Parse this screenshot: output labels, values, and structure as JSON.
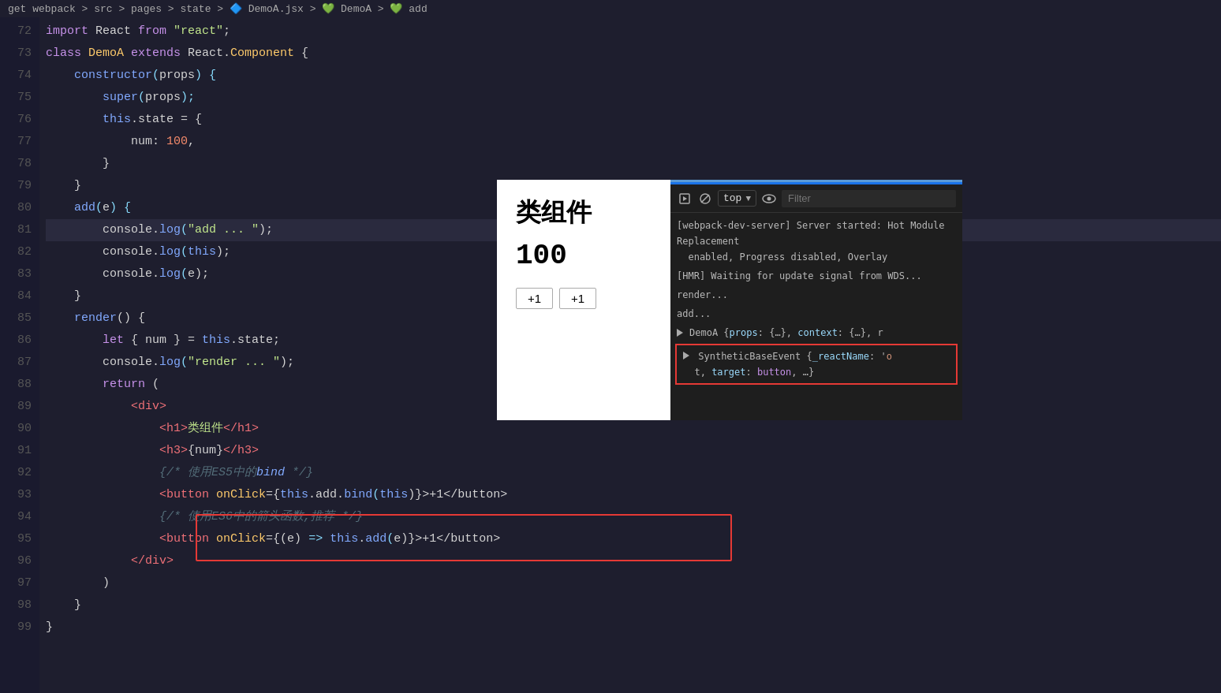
{
  "breadcrumb": {
    "parts": [
      "get webpack",
      ">",
      "src",
      ">",
      "pages",
      ">",
      "state",
      ">",
      "🔷 DemoA.jsx",
      ">",
      "💚 DemoA",
      ">",
      "💚 add"
    ]
  },
  "editor": {
    "lines": [
      {
        "num": 72,
        "tokens": [
          {
            "t": "import",
            "c": "kw-import"
          },
          {
            "t": " React ",
            "c": "plain"
          },
          {
            "t": "from",
            "c": "kw-from"
          },
          {
            "t": " ",
            "c": "plain"
          },
          {
            "t": "\"react\"",
            "c": "str"
          },
          {
            "t": ";",
            "c": "plain"
          }
        ]
      },
      {
        "num": 73,
        "tokens": [
          {
            "t": "class",
            "c": "kw-class"
          },
          {
            "t": " ",
            "c": "plain"
          },
          {
            "t": "DemoA",
            "c": "class-name"
          },
          {
            "t": " ",
            "c": "plain"
          },
          {
            "t": "extends",
            "c": "kw-extends"
          },
          {
            "t": " React.",
            "c": "plain"
          },
          {
            "t": "Component",
            "c": "class-name"
          },
          {
            "t": " {",
            "c": "plain"
          }
        ]
      },
      {
        "num": 74,
        "tokens": [
          {
            "t": "    ",
            "c": "plain"
          },
          {
            "t": "constructor",
            "c": "fn-name"
          },
          {
            "t": "(",
            "c": "paren"
          },
          {
            "t": "props",
            "c": "plain"
          },
          {
            "t": ") {",
            "c": "paren"
          }
        ]
      },
      {
        "num": 75,
        "tokens": [
          {
            "t": "        ",
            "c": "plain"
          },
          {
            "t": "super",
            "c": "fn-name"
          },
          {
            "t": "(",
            "c": "paren"
          },
          {
            "t": "props",
            "c": "plain"
          },
          {
            "t": ");",
            "c": "paren"
          }
        ]
      },
      {
        "num": 76,
        "tokens": [
          {
            "t": "        ",
            "c": "plain"
          },
          {
            "t": "this",
            "c": "kw-this"
          },
          {
            "t": ".state = {",
            "c": "plain"
          }
        ]
      },
      {
        "num": 77,
        "tokens": [
          {
            "t": "            ",
            "c": "plain"
          },
          {
            "t": "num",
            "c": "plain"
          },
          {
            "t": ": ",
            "c": "plain"
          },
          {
            "t": "100",
            "c": "num"
          },
          {
            "t": ",",
            "c": "plain"
          }
        ]
      },
      {
        "num": 78,
        "tokens": [
          {
            "t": "        ",
            "c": "plain"
          },
          {
            "t": "}",
            "c": "plain"
          }
        ]
      },
      {
        "num": 79,
        "tokens": [
          {
            "t": "    ",
            "c": "plain"
          },
          {
            "t": "}",
            "c": "plain"
          }
        ]
      },
      {
        "num": 80,
        "tokens": [
          {
            "t": "    ",
            "c": "plain"
          },
          {
            "t": "add",
            "c": "fn-name"
          },
          {
            "t": "(",
            "c": "paren"
          },
          {
            "t": "e",
            "c": "plain"
          },
          {
            "t": ") {",
            "c": "paren"
          }
        ]
      },
      {
        "num": 81,
        "tokens": [
          {
            "t": "        ",
            "c": "plain"
          },
          {
            "t": "console",
            "c": "plain"
          },
          {
            "t": ".",
            "c": "plain"
          },
          {
            "t": "log",
            "c": "method"
          },
          {
            "t": "(",
            "c": "paren"
          },
          {
            "t": "\"add ... \"",
            "c": "str"
          },
          {
            "t": ");",
            "c": "plain"
          }
        ],
        "highlighted": true
      },
      {
        "num": 82,
        "tokens": [
          {
            "t": "        ",
            "c": "plain"
          },
          {
            "t": "console",
            "c": "plain"
          },
          {
            "t": ".",
            "c": "plain"
          },
          {
            "t": "log",
            "c": "method"
          },
          {
            "t": "(",
            "c": "paren"
          },
          {
            "t": "this",
            "c": "kw-this"
          },
          {
            "t": ");",
            "c": "plain"
          }
        ]
      },
      {
        "num": 83,
        "tokens": [
          {
            "t": "        ",
            "c": "plain"
          },
          {
            "t": "console",
            "c": "plain"
          },
          {
            "t": ".",
            "c": "plain"
          },
          {
            "t": "log",
            "c": "method"
          },
          {
            "t": "(",
            "c": "paren"
          },
          {
            "t": "e",
            "c": "plain"
          },
          {
            "t": ");",
            "c": "plain"
          }
        ]
      },
      {
        "num": 84,
        "tokens": [
          {
            "t": "    ",
            "c": "plain"
          },
          {
            "t": "}",
            "c": "plain"
          }
        ]
      },
      {
        "num": 85,
        "tokens": [
          {
            "t": "    ",
            "c": "plain"
          },
          {
            "t": "render",
            "c": "fn-name"
          },
          {
            "t": "() {",
            "c": "plain"
          }
        ]
      },
      {
        "num": 86,
        "tokens": [
          {
            "t": "        ",
            "c": "plain"
          },
          {
            "t": "let",
            "c": "kw-let"
          },
          {
            "t": " { ",
            "c": "plain"
          },
          {
            "t": "num",
            "c": "plain"
          },
          {
            "t": " } = ",
            "c": "plain"
          },
          {
            "t": "this",
            "c": "kw-this"
          },
          {
            "t": ".state;",
            "c": "plain"
          }
        ]
      },
      {
        "num": 87,
        "tokens": [
          {
            "t": "        ",
            "c": "plain"
          },
          {
            "t": "console",
            "c": "plain"
          },
          {
            "t": ".",
            "c": "plain"
          },
          {
            "t": "log",
            "c": "method"
          },
          {
            "t": "(",
            "c": "paren"
          },
          {
            "t": "\"render ... \"",
            "c": "str"
          },
          {
            "t": ");",
            "c": "plain"
          }
        ]
      },
      {
        "num": 88,
        "tokens": [
          {
            "t": "        ",
            "c": "plain"
          },
          {
            "t": "return",
            "c": "kw-return"
          },
          {
            "t": " (",
            "c": "plain"
          }
        ]
      },
      {
        "num": 89,
        "tokens": [
          {
            "t": "            ",
            "c": "plain"
          },
          {
            "t": "<",
            "c": "tag"
          },
          {
            "t": "div",
            "c": "tag"
          },
          {
            "t": ">",
            "c": "tag"
          }
        ]
      },
      {
        "num": 90,
        "tokens": [
          {
            "t": "                ",
            "c": "plain"
          },
          {
            "t": "<",
            "c": "tag"
          },
          {
            "t": "h1",
            "c": "tag"
          },
          {
            "t": ">",
            "c": "tag"
          },
          {
            "t": "类组件",
            "c": "jsx-text"
          },
          {
            "t": "</",
            "c": "tag"
          },
          {
            "t": "h1",
            "c": "tag"
          },
          {
            "t": ">",
            "c": "tag"
          }
        ]
      },
      {
        "num": 91,
        "tokens": [
          {
            "t": "                ",
            "c": "plain"
          },
          {
            "t": "<",
            "c": "tag"
          },
          {
            "t": "h3",
            "c": "tag"
          },
          {
            "t": ">",
            "c": "tag"
          },
          {
            "t": "{",
            "c": "plain"
          },
          {
            "t": "num",
            "c": "plain"
          },
          {
            "t": "}",
            "c": "plain"
          },
          {
            "t": "</",
            "c": "tag"
          },
          {
            "t": "h3",
            "c": "tag"
          },
          {
            "t": ">",
            "c": "tag"
          }
        ]
      },
      {
        "num": 92,
        "tokens": [
          {
            "t": "                ",
            "c": "plain"
          },
          {
            "t": "{/* 使用ES5中的",
            "c": "comment"
          },
          {
            "t": "bind",
            "c": "comment"
          },
          {
            "t": " */}",
            "c": "comment"
          }
        ]
      },
      {
        "num": 93,
        "tokens": [
          {
            "t": "                ",
            "c": "plain"
          },
          {
            "t": "<",
            "c": "tag"
          },
          {
            "t": "button",
            "c": "tag"
          },
          {
            "t": " ",
            "c": "plain"
          },
          {
            "t": "onClick",
            "c": "attr"
          },
          {
            "t": "=",
            "c": "plain"
          },
          {
            "t": "{",
            "c": "plain"
          },
          {
            "t": "this",
            "c": "kw-this"
          },
          {
            "t": ".add.",
            "c": "plain"
          },
          {
            "t": "bind",
            "c": "method"
          },
          {
            "t": "(",
            "c": "paren"
          },
          {
            "t": "this",
            "c": "kw-this"
          },
          {
            "t": ")}",
            "c": "plain"
          },
          {
            "t": ">",
            "c": "tag"
          },
          {
            "t": "+1",
            "c": "plain"
          },
          {
            "t": "</",
            "c": "tag"
          },
          {
            "t": "button",
            "c": "tag"
          },
          {
            "t": ">",
            "c": "tag"
          }
        ]
      },
      {
        "num": 94,
        "tokens": [
          {
            "t": "                ",
            "c": "plain"
          },
          {
            "t": "{/* 使用ES6中的箭头函数,推荐 */}",
            "c": "comment"
          }
        ],
        "redBorder": true
      },
      {
        "num": 95,
        "tokens": [
          {
            "t": "                ",
            "c": "plain"
          },
          {
            "t": "<",
            "c": "tag"
          },
          {
            "t": "button",
            "c": "tag"
          },
          {
            "t": " ",
            "c": "plain"
          },
          {
            "t": "onClick",
            "c": "attr"
          },
          {
            "t": "=",
            "c": "plain"
          },
          {
            "t": "{(",
            "c": "plain"
          },
          {
            "t": "e",
            "c": "plain"
          },
          {
            "t": ") ",
            "c": "plain"
          },
          {
            "t": "=>",
            "c": "arrow"
          },
          {
            "t": " ",
            "c": "plain"
          },
          {
            "t": "this",
            "c": "kw-this"
          },
          {
            "t": ".",
            "c": "plain"
          },
          {
            "t": "add",
            "c": "method"
          },
          {
            "t": "(",
            "c": "paren"
          },
          {
            "t": "e",
            "c": "plain"
          },
          {
            "t": ")}",
            "c": "plain"
          },
          {
            "t": ">",
            "c": "tag"
          },
          {
            "t": "+1",
            "c": "plain"
          },
          {
            "t": "</",
            "c": "tag"
          },
          {
            "t": "button",
            "c": "tag"
          },
          {
            "t": ">",
            "c": "tag"
          }
        ],
        "redBorder": true
      },
      {
        "num": 96,
        "tokens": [
          {
            "t": "            ",
            "c": "plain"
          },
          {
            "t": "</",
            "c": "tag"
          },
          {
            "t": "div",
            "c": "tag"
          },
          {
            "t": ">",
            "c": "tag"
          }
        ]
      },
      {
        "num": 97,
        "tokens": [
          {
            "t": "        ",
            "c": "plain"
          },
          {
            "t": ")",
            "c": "plain"
          }
        ]
      },
      {
        "num": 98,
        "tokens": [
          {
            "t": "    ",
            "c": "plain"
          },
          {
            "t": "}",
            "c": "plain"
          }
        ]
      },
      {
        "num": 99,
        "tokens": [
          {
            "t": "}",
            "c": "plain"
          }
        ]
      }
    ]
  },
  "preview": {
    "title": "类组件",
    "count": "100",
    "btn1": "+1",
    "btn2": "+1"
  },
  "devtools": {
    "filter_placeholder": "Filter",
    "top_label": "top",
    "log_lines": [
      "[webpack-dev-server] Server started: Hot Module Replacement enabled, Progress disabled, Overlay",
      "[HMR] Waiting for update signal from WDS...",
      "render...",
      "add...",
      "▶ DemoA {props: {…}, context: {…}, r"
    ],
    "synthetic_event": "SyntheticBaseEvent {_reactName: 'o\nt, target: button, …}"
  }
}
